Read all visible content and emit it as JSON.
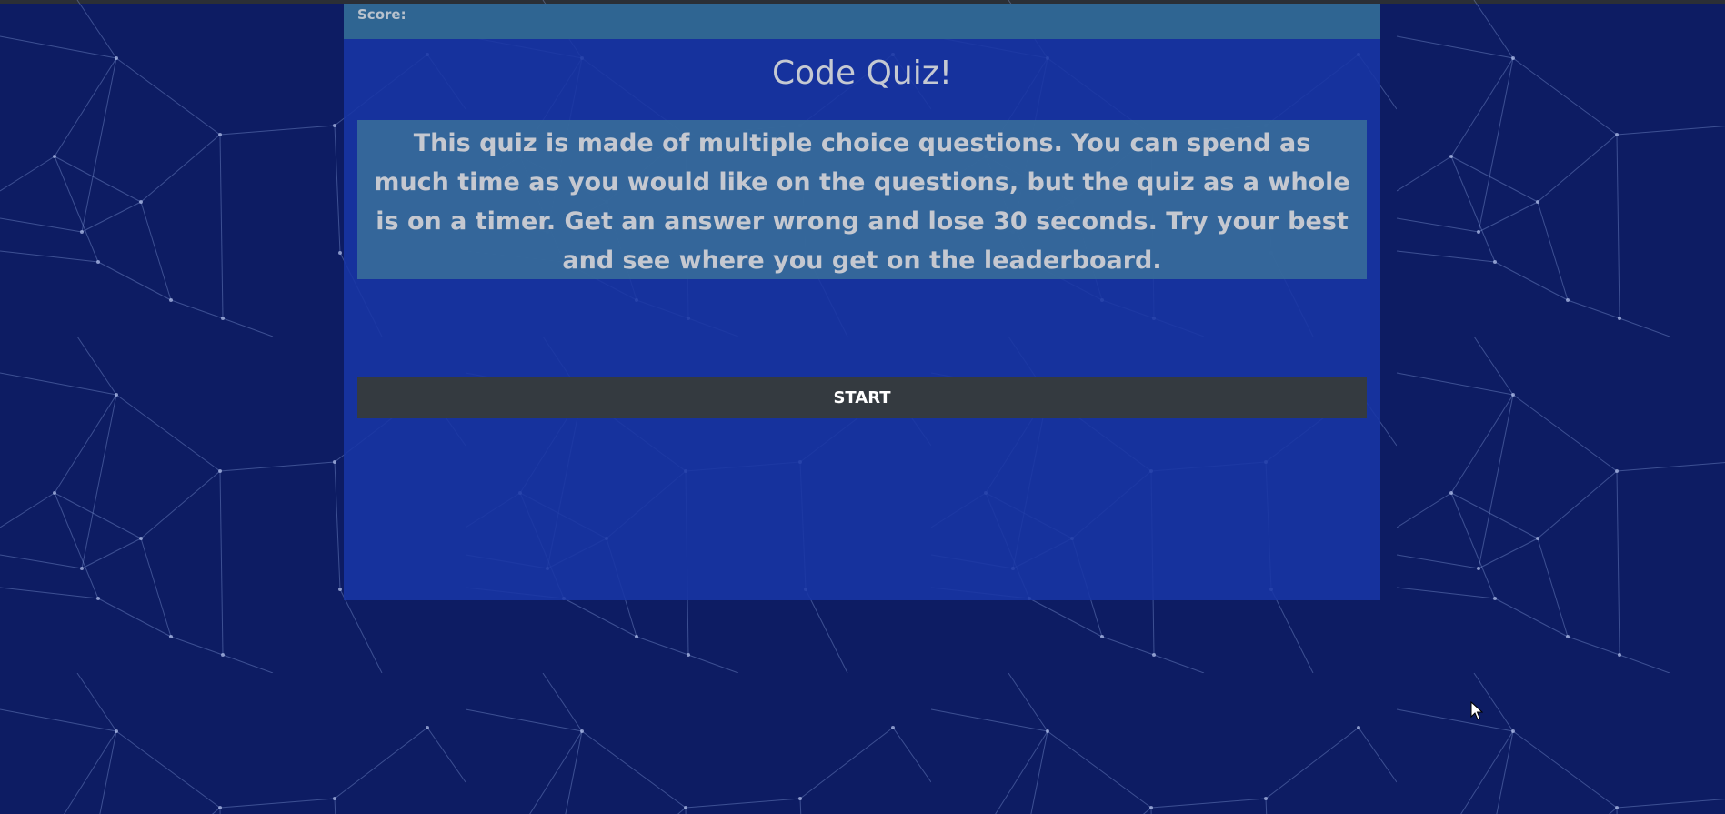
{
  "score": {
    "label": "Score:"
  },
  "quiz": {
    "title": "Code Quiz!",
    "description": "This quiz is made of multiple choice questions. You can spend as much time as you would like on the questions, but the quiz as a whole is on a timer. Get an answer wrong and lose 30 seconds. Try your best and see where you get on the leaderboard.",
    "start_label": "START"
  },
  "colors": {
    "background": "#0d1c63",
    "panel": "#1836a5",
    "score_bar": "#2f6592",
    "description_box": "#376a9a",
    "start_button": "#343a40"
  },
  "icons": {
    "background": "network-lines-pattern",
    "pointer": "mouse-cursor-icon"
  }
}
